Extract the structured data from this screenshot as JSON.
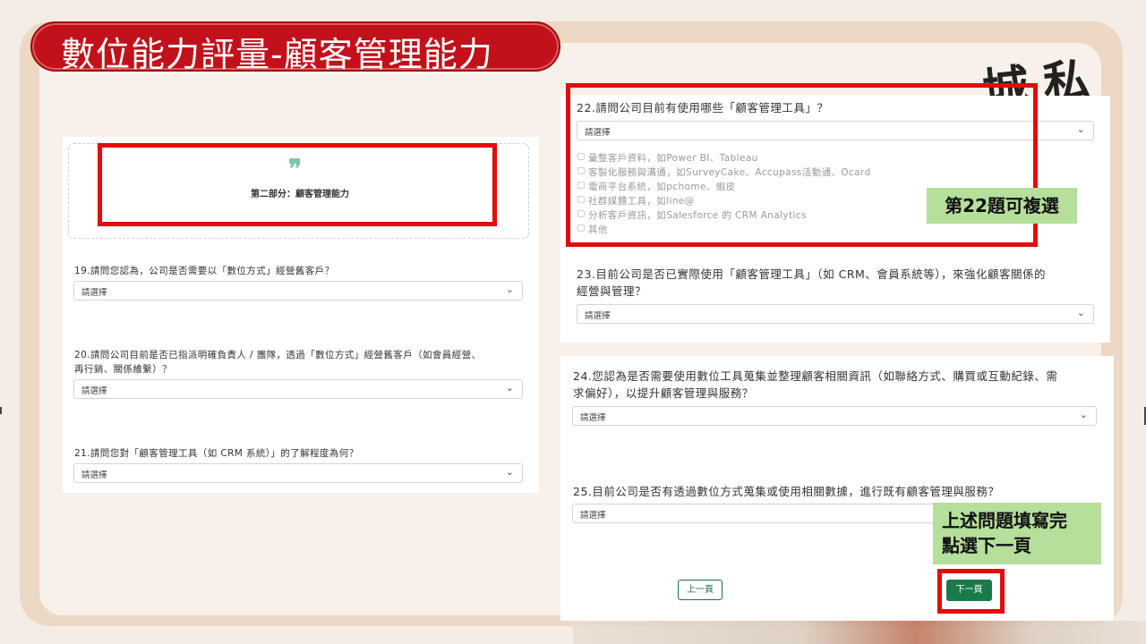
{
  "title": "數位能力評量-顧客管理能力",
  "deco_brush_text": "城私",
  "left_panel": {
    "section_title": "第二部分：顧客管理能力",
    "questions": [
      {
        "text": "19.請問您認為，公司是否需要以「數位方式」經營舊客戶？",
        "select": "請選擇"
      },
      {
        "text_line1": "20.請問公司目前是否已指派明確負責人 / 團隊，透過「數位方式」經營舊客戶（如會員經營、",
        "text_line2": "再行銷、關係維繫）？",
        "select": "請選擇"
      },
      {
        "text": "21.請問您對「顧客管理工具（如 CRM 系統）」的了解程度為何？",
        "select": "請選擇"
      }
    ]
  },
  "right_panel": {
    "q22": {
      "text": "22.請問公司目前有使用哪些「顧客管理工具」？",
      "select": "請選擇",
      "options": [
        "彙整客戶資料，如Power BI、Tableau",
        "客製化服務與溝通，如SurveyCake、Accupass活動通、Ocard",
        "電商平台系統，如pchome、蝦皮",
        "社群媒體工具，如line@",
        "分析客戶資訊，如Salesforce 的 CRM Analytics",
        "其他"
      ]
    },
    "q23": {
      "text_line1": "23.目前公司是否已實際使用「顧客管理工具」（如 CRM、會員系統等），來強化顧客關係的",
      "text_line2": "經營與管理？",
      "select": "請選擇"
    },
    "q24": {
      "text_line1": "24.您認為是否需要使用數位工具蒐集並整理顧客相關資訊（如聯絡方式、購買或互動紀錄、需",
      "text_line2": "求偏好），以提升顧客管理與服務？",
      "select": "請選擇"
    },
    "q25": {
      "text": "25.目前公司是否有透過數位方式蒐集或使用相關數據，進行既有顧客管理與服務？",
      "select": "請選擇"
    },
    "prev_button": "上一頁",
    "next_button": "下一頁"
  },
  "annotations": {
    "q22_note": "第22題可複選",
    "next_note_line1": "上述問題填寫完",
    "next_note_line2": "點選下一頁"
  },
  "colors": {
    "banner": "#c1121b",
    "highlight_border": "#e30b0b",
    "note_bg": "#b5df9a",
    "button_green": "#1c7a4a"
  }
}
